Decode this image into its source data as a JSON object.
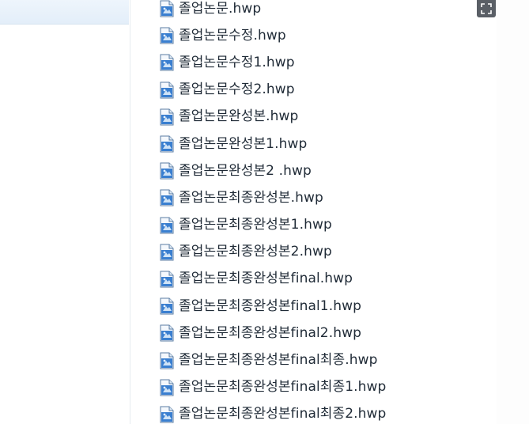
{
  "files": [
    {
      "name": "졸업논문.hwp",
      "icon": "hwp-document-icon"
    },
    {
      "name": "졸업논문수정.hwp",
      "icon": "hwp-document-icon"
    },
    {
      "name": "졸업논문수정1.hwp",
      "icon": "hwp-document-icon"
    },
    {
      "name": "졸업논문수정2.hwp",
      "icon": "hwp-document-icon"
    },
    {
      "name": "졸업논문완성본.hwp",
      "icon": "hwp-document-icon"
    },
    {
      "name": "졸업논문완성본1.hwp",
      "icon": "hwp-document-icon"
    },
    {
      "name": "졸업논문완성본2 .hwp",
      "icon": "hwp-document-icon"
    },
    {
      "name": "졸업논문최종완성본.hwp",
      "icon": "hwp-document-icon"
    },
    {
      "name": "졸업논문최종완성본1.hwp",
      "icon": "hwp-document-icon"
    },
    {
      "name": "졸업논문최종완성본2.hwp",
      "icon": "hwp-document-icon"
    },
    {
      "name": "졸업논문최종완성본final.hwp",
      "icon": "hwp-document-icon"
    },
    {
      "name": "졸업논문최종완성본final1.hwp",
      "icon": "hwp-document-icon"
    },
    {
      "name": "졸업논문최종완성본final2.hwp",
      "icon": "hwp-document-icon"
    },
    {
      "name": "졸업논문최종완성본final최종.hwp",
      "icon": "hwp-document-icon"
    },
    {
      "name": "졸업논문최종완성본final최종1.hwp",
      "icon": "hwp-document-icon"
    },
    {
      "name": "졸업논문최종완성본final최종2.hwp",
      "icon": "hwp-document-icon"
    }
  ],
  "expand_icon": "fullscreen-icon",
  "colors": {
    "icon_blue": "#3a7fd0",
    "icon_light": "#cfe3f7",
    "text": "#1f2a36"
  }
}
